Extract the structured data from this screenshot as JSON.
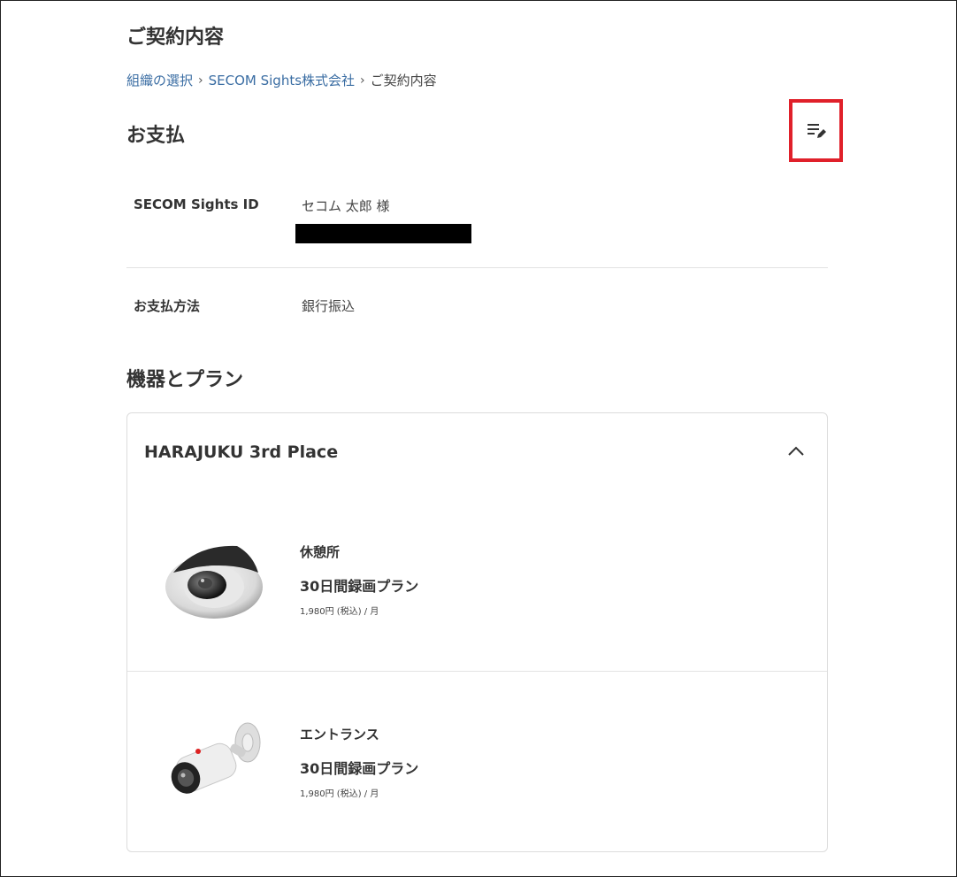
{
  "page": {
    "title": "ご契約内容",
    "breadcrumb": [
      {
        "label": "組織の選択",
        "link": true
      },
      {
        "label": "SECOM Sights株式会社",
        "link": true
      },
      {
        "label": "ご契約内容",
        "link": false
      }
    ]
  },
  "payment": {
    "section_title": "お支払",
    "edit_icon": "edit-list-icon",
    "id_label": "SECOM Sights ID",
    "id_value": "セコム 太郎 様",
    "method_label": "お支払方法",
    "method_value": "銀行振込"
  },
  "plans": {
    "section_title": "機器とプラン",
    "location": {
      "name": "HARAJUKU 3rd Place",
      "expand_icon": "chevron-up-icon",
      "devices": [
        {
          "name": "休憩所",
          "plan": "30日間録画プラン",
          "price": "1,980円 (税込) / 月",
          "image": "dome-camera-image"
        },
        {
          "name": "エントランス",
          "plan": "30日間録画プラン",
          "price": "1,980円 (税込) / 月",
          "image": "bullet-camera-image"
        }
      ]
    }
  },
  "colors": {
    "link": "#3a6da3",
    "highlight": "#e0202a",
    "text": "#333333"
  }
}
